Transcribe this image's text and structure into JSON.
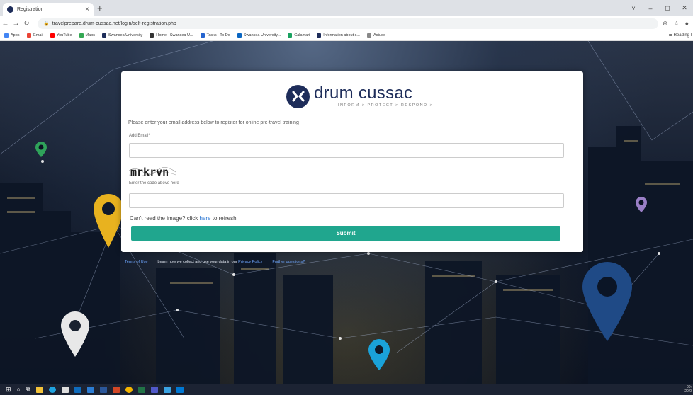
{
  "browser": {
    "tab_title": "Registration",
    "tab_close": "×",
    "new_tab": "+",
    "url": "travelprepare.drum-cussac.net/login/self-registration.php",
    "window_controls": [
      "˅",
      "–",
      "◻",
      "✕"
    ],
    "bookmarks": [
      {
        "label": "Apps",
        "color": "#4285f4"
      },
      {
        "label": "Gmail",
        "color": "#ea4335"
      },
      {
        "label": "YouTube",
        "color": "#ff0000"
      },
      {
        "label": "Maps",
        "color": "#34a853"
      },
      {
        "label": "Swansea University",
        "color": "#1e2d5a"
      },
      {
        "label": "Home - Swansea U...",
        "color": "#333333"
      },
      {
        "label": "Tasks - To Do",
        "color": "#2564cf"
      },
      {
        "label": "Swansea University...",
        "color": "#0a66c2"
      },
      {
        "label": "Calamari",
        "color": "#1aa260"
      },
      {
        "label": "Information about s...",
        "color": "#1e2d5a"
      },
      {
        "label": "Astudo",
        "color": "#888888"
      }
    ],
    "reading_list": "Reading l"
  },
  "form": {
    "brand_name": "drum cussac",
    "brand_tagline": "INFORM > PROTECT > RESPOND >",
    "intro": "Please enter your email address below to register for online pre-travel training",
    "email_label": "Add Email*",
    "email_value": "",
    "captcha_text": "mrkrvn",
    "code_label": "Enter the code above here",
    "code_value": "",
    "refresh_prefix": "Can't read the image? click",
    "refresh_link": "here",
    "refresh_suffix": "to refresh.",
    "submit_label": "Submit"
  },
  "footer": {
    "terms": "Terms of Use",
    "privacy_text": "Learn how we collect and use your data in our",
    "privacy_link": "Privacy Policy",
    "questions": "Further questions?"
  },
  "taskbar": {
    "time": "09:",
    "date": "20/0"
  },
  "colors": {
    "brand": "#1e2d5a",
    "submit": "#20a68e",
    "link": "#1e6fd1"
  }
}
